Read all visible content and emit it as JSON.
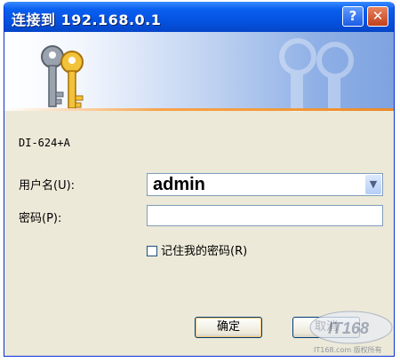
{
  "window": {
    "title": "连接到 192.168.0.1"
  },
  "titlebar": {
    "help_glyph": "?",
    "close_glyph": "✕"
  },
  "icons": {
    "banner": "keys-icon",
    "help": "help-icon",
    "close": "close-icon",
    "dropdown": "chevron-down-icon"
  },
  "colors": {
    "titlebar": "#0553e2",
    "dialog_bg": "#ece9d8",
    "accent_line": "#f29a3a",
    "close_button": "#c0401c"
  },
  "dialog": {
    "device_name": "DI-624+A",
    "username_label": "用户名(U):",
    "password_label": "密码(P):",
    "username_value": "admin",
    "password_value": "",
    "remember_label": "记住我的密码(R)",
    "remember_checked": false
  },
  "buttons": {
    "ok": "确定",
    "cancel": "取消"
  },
  "watermark": {
    "logo": "IT168",
    "caption": "IT168.com 版权所有"
  }
}
